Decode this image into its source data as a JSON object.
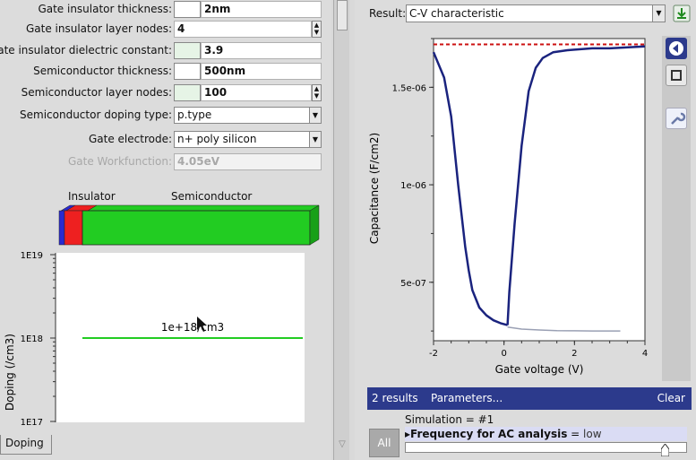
{
  "params": [
    {
      "label": "Gate insulator thickness:",
      "value": "2nm",
      "kind": "input-swatch"
    },
    {
      "label": "Gate insulator layer nodes:",
      "value": "4",
      "kind": "spin"
    },
    {
      "label": "Gate insulator dielectric constant:",
      "value": "3.9",
      "kind": "input-swatch-green"
    },
    {
      "label": "Semiconductor thickness:",
      "value": "500nm",
      "kind": "input-swatch"
    },
    {
      "label": "Semiconductor layer nodes:",
      "value": "100",
      "kind": "spin-swatch"
    },
    {
      "label": "Semiconductor doping type:",
      "value": "p.type",
      "kind": "select"
    },
    {
      "label": "Gate electrode:",
      "value": "n+ poly silicon",
      "kind": "select"
    },
    {
      "label": "Gate Workfunction:",
      "value": "4.05eV",
      "kind": "disabled"
    }
  ],
  "structure": {
    "insulator_label": "Insulator",
    "semiconductor_label": "Semiconductor",
    "colors": {
      "gate": "#2a2ad0",
      "insulator": "#ee2020",
      "semiconductor": "#22cc22"
    }
  },
  "doping_plot": {
    "ylabel": "Doping (/cm3)",
    "ticks": [
      "1E19",
      "1E18",
      "1E17"
    ],
    "annotation": "1e+18/cm3",
    "level_exponent": 18,
    "line_color": "#22cc22"
  },
  "doping_tab": "Doping",
  "result": {
    "label": "Result:",
    "selected": "C-V characteristic"
  },
  "chart_data": {
    "type": "line",
    "xlabel": "Gate voltage (V)",
    "ylabel": "Capacitance (F/cm2)",
    "xlim": [
      -2,
      4
    ],
    "ylim": [
      2e-07,
      1.75e-06
    ],
    "xticks": [
      "-2",
      "0",
      "2",
      "4"
    ],
    "yticks": [
      "5e-07",
      "1e-06",
      "1.5e-06"
    ],
    "ytick_values": [
      5e-07,
      1e-06,
      1.5e-06
    ],
    "series": [
      {
        "style": "solid",
        "color": "#1a237e",
        "x": [
          -2.0,
          -1.7,
          -1.5,
          -1.3,
          -1.1,
          -1.0,
          -0.9,
          -0.7,
          -0.5,
          -0.3,
          -0.1,
          0.1
        ],
        "y": [
          1.68e-06,
          1.55e-06,
          1.35e-06,
          1e-06,
          6.8e-07,
          5.6e-07,
          4.6e-07,
          3.7e-07,
          3.3e-07,
          3.05e-07,
          2.9e-07,
          2.8e-07
        ]
      },
      {
        "style": "solid",
        "color": "#1a237e",
        "x": [
          0.1,
          0.15,
          0.3,
          0.5,
          0.7,
          0.9,
          1.1,
          1.4,
          1.8,
          2.5,
          3.0,
          4.0
        ],
        "y": [
          2.8e-07,
          4.5e-07,
          8e-07,
          1.2e-06,
          1.48e-06,
          1.6e-06,
          1.65e-06,
          1.68e-06,
          1.69e-06,
          1.7e-06,
          1.7e-06,
          1.71e-06
        ]
      },
      {
        "style": "solid",
        "color": "#9aa0b4",
        "x": [
          0.1,
          0.5,
          1.0,
          1.5,
          2.0,
          2.5,
          3.0,
          3.3
        ],
        "y": [
          2.7e-07,
          2.6e-07,
          2.55e-07,
          2.52e-07,
          2.51e-07,
          2.5e-07,
          2.5e-07,
          2.5e-07
        ]
      },
      {
        "style": "dashed",
        "color": "#cc1111",
        "x": [
          -2.0,
          4.0
        ],
        "y": [
          1.72e-06,
          1.72e-06
        ]
      }
    ]
  },
  "results_bar": {
    "count": "2 results",
    "parameters": "Parameters...",
    "clear": "Clear"
  },
  "simulation": {
    "label": "Simulation = #1",
    "all_button": "All",
    "param_name": "Frequency for AC analysis",
    "param_eq": " = ",
    "param_value": "low",
    "slider_fraction": 0.92
  },
  "accent_color": "#2c3a8c"
}
